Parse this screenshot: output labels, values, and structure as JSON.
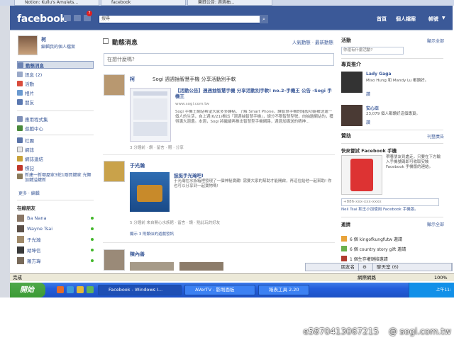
{
  "browser": {
    "tabs": [
      "Notion: Kullu's Amulets...",
      "facebook",
      "樂鈺公告: 週週抽..."
    ]
  },
  "header": {
    "logo": "facebook",
    "notification_count": "7",
    "search_value": "搜尋",
    "links": [
      "首頁",
      "個人檔案",
      "帳號"
    ]
  },
  "left": {
    "profile_name": "柯",
    "edit_profile": "編輯我的個人檔案",
    "nav": [
      {
        "label": "動態消息",
        "icon": "news-feed-icon"
      },
      {
        "label": "訊息 (2)",
        "icon": "messages-icon"
      },
      {
        "label": "活動",
        "icon": "events-icon"
      },
      {
        "label": "相片",
        "icon": "photos-icon"
      },
      {
        "label": "朋友",
        "icon": "friends-icon"
      },
      {
        "label": "應用程式集",
        "icon": "apps-icon"
      },
      {
        "label": "遊戲中心",
        "icon": "games-icon"
      },
      {
        "label": "社團",
        "icon": "groups-icon"
      },
      {
        "label": "網誌",
        "icon": "notes-icon"
      },
      {
        "label": "網誌連結",
        "icon": "links-icon"
      },
      {
        "label": "標記",
        "icon": "tags-icon"
      },
      {
        "label": "新建一新哪屋家3蛇1剛買鍵家 光舞加鍵溢鍵新",
        "icon": "page-icon"
      }
    ],
    "more_link": "更多 · 編輯",
    "online_title": "在線朋友",
    "online": [
      "Ba Nana",
      "Wayne Tsai",
      "于光瀚",
      "胡坤信",
      "羅方瑋"
    ]
  },
  "main": {
    "title": "動態消息",
    "tabs": "人氣動態 · 最新動態",
    "status_placeholder": "在想什麼嗎?",
    "story1": {
      "name": "柯",
      "message": "Sogi 週週抽智慧手機 分享活動別手軟",
      "link_title": "【活動公告】週週抽智慧手機 分享活動別手軟! no.2-手機王 公告 -Sogi 手機王",
      "link_url": "www.sogi.com.tw",
      "link_desc": "Sogi 手機王網站希望大家多多轉貼、了解 Smart Phone，讓智慧手機的諸般功能被送進一個人的生活，自上週(6/21)推出「週週抽智慧手機」，總分不限智慧型號，向抽題網站的，獲得滿大週邊。本週，Sogi 將繼續再推出智慧型手機網路，週週加碼送的精神...",
      "meta": "3 分鐘前 · 讚 · 留言 · 贈 · 分享"
    },
    "story2": {
      "name": "于光瀚",
      "app_title": "挺挺手光瀚吧!",
      "app_desc": "于光瀚在水族箱裡發現了一個神秘寶藏! 需要大家的幫助才能開啟，再這位給他一起幫助! 你也可以分享到一起寶物嗎!",
      "meta": "5 分鐘前 來自開心水族館 · 留言 · 讚 · 點此玩的好友",
      "more": "顯示 3 則類似的遊戲發訊"
    },
    "story3": {
      "name": "陳內善"
    }
  },
  "right": {
    "events_title": "活動",
    "see_all": "顯示全部",
    "events_placeholder": "你還有什麼活動?",
    "rec_title": "專頁推介",
    "rec1_name": "Lady Gaga",
    "rec1_desc": "Miso Hung 和 Mandy Lu 都讚好。",
    "rec1_like": "讚",
    "rec2_name": "安心亞",
    "rec2_desc": "23,079 個人都讚好這個專頁。",
    "rec2_like": "讚",
    "sponsored": "贊助",
    "create_ad": "刊登廣告",
    "mobile_title": "快來嘗試 Facebook 手機",
    "mobile_desc": "帶著朋友到處走，只要在下方輸入手機號碼即可收取安裝 Facebook 手機版的連結。",
    "phone_placeholder": "+886-xxx-xxx-xxxx",
    "mobile_note": "Neil Tsai 和王小加使用 Facebook 手機版。",
    "invites_title": "邀請",
    "invites": [
      "6 個 kingofkungfutw 邀請",
      "6 個 country story gift 邀請",
      "1 個生存權鏈接邀請"
    ]
  },
  "chatbar": {
    "friends": "朋友名",
    "chat": "聊天室 (6)"
  },
  "statusbar": {
    "left": "完成",
    "zone": "網際網路",
    "zoom": "100%"
  },
  "taskbar": {
    "start": "開始",
    "windows": [
      "Facebook - Windows I...",
      "AVerTV - 影剛面板",
      "報表工具 2.20"
    ],
    "clock": "上午11:"
  },
  "watermark": {
    "id": "e5870413067215",
    "site": "@ sogi.com.tw"
  }
}
